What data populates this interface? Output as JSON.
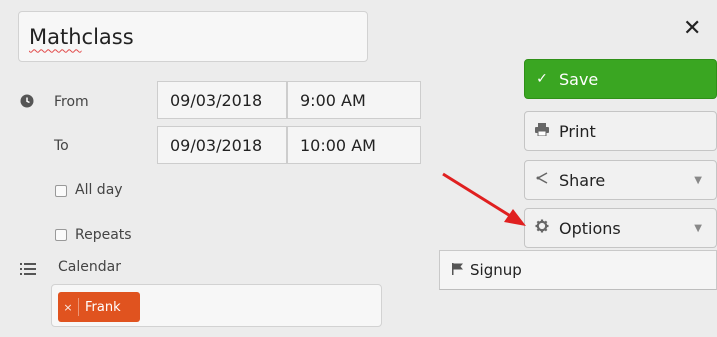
{
  "title": {
    "before_spell": "",
    "spell_word": "Math",
    "after_spell": " class"
  },
  "close_glyph": "✕",
  "from": {
    "label": "From",
    "date": "09/03/2018",
    "time": "9:00 AM"
  },
  "to": {
    "label": "To",
    "date": "09/03/2018",
    "time": "10:00 AM"
  },
  "all_day": {
    "label": "All day",
    "checked": false
  },
  "repeats": {
    "label": "Repeats",
    "checked": false
  },
  "calendar": {
    "label": "Calendar",
    "tag_label": "Frank",
    "tag_remove": "×"
  },
  "actions": {
    "save": "Save",
    "print": "Print",
    "share": "Share",
    "options": "Options"
  },
  "options_menu": {
    "items": [
      {
        "label": "Signup",
        "icon": "flag-icon"
      }
    ]
  },
  "colors": {
    "save_green": "#3aa622",
    "tag_orange": "#e0531f",
    "arrow_red": "#e02020"
  },
  "icons": {
    "from": "clock-icon",
    "calendar": "list-icon",
    "save": "check-icon",
    "print": "printer-icon",
    "share": "share-icon",
    "options": "gear-icon",
    "caret": "caret-down-icon"
  }
}
